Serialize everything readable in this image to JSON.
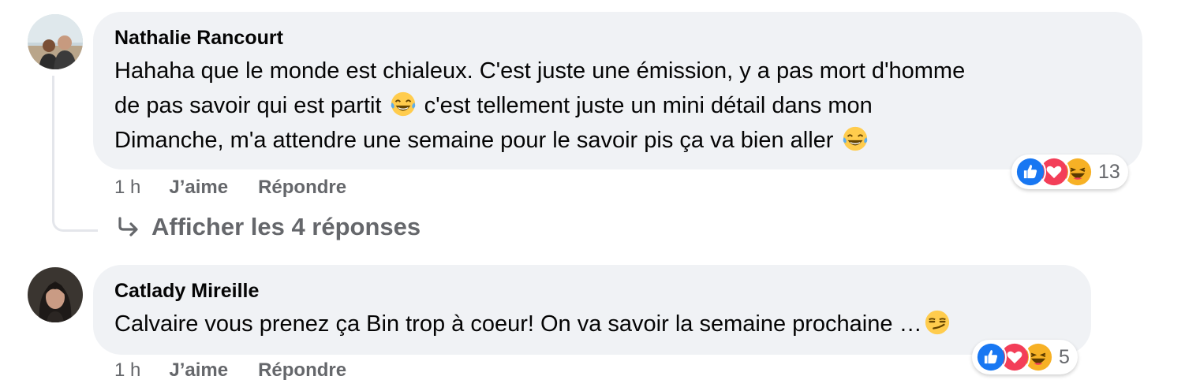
{
  "comments": [
    {
      "author": "Nathalie Rancourt",
      "text_line1": "Hahaha que le monde est chialeux. C'est juste une émission, y a pas mort d'homme",
      "text_line2a": "de pas savoir qui est partit",
      "text_line2b": "c'est tellement juste un mini détail dans mon",
      "text_line3": "Dimanche, m'a attendre une semaine pour le savoir pis ça va bien aller",
      "reaction_count": "13",
      "time": "1 h",
      "like_label": "J’aime",
      "reply_label": "Répondre",
      "emoji_icons": [
        "laughing-tears-emoji",
        "laughing-tears-emoji"
      ],
      "reaction_icons": [
        "like-reaction-icon",
        "love-reaction-icon",
        "haha-reaction-icon"
      ]
    },
    {
      "author": "Catlady Mireille",
      "text_line1": "Calvaire vous prenez ça Bin trop à coeur! On va savoir la semaine prochaine …",
      "reaction_count": "5",
      "time": "1 h",
      "like_label": "J’aime",
      "reply_label": "Répondre",
      "emoji_icons": [
        "smirk-emoji"
      ],
      "reaction_icons": [
        "like-reaction-icon",
        "love-reaction-icon",
        "haha-reaction-icon"
      ]
    }
  ],
  "replies_link": {
    "label": "Afficher les 4 réponses",
    "icon": "reply-arrow-icon"
  },
  "colors": {
    "bubble_bg": "#f0f2f5",
    "meta_text": "#65676b",
    "like_blue": "#1877f2",
    "love_red": "#f33e58",
    "haha_yellow": "#f7b125"
  }
}
